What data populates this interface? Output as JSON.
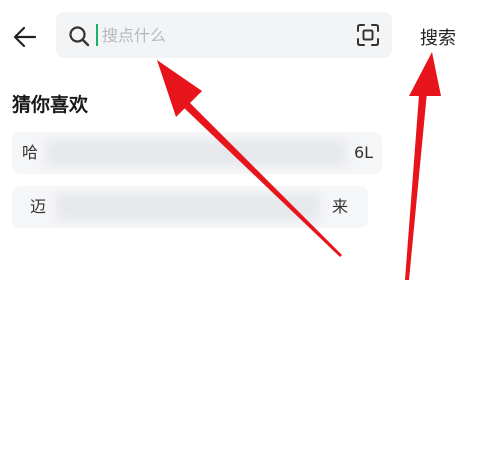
{
  "header": {
    "back_icon": "arrow-left-icon",
    "search": {
      "placeholder": "搜点什么",
      "value": "",
      "search_icon": "search-icon",
      "scan_icon": "scan-icon"
    },
    "search_button_label": "搜索"
  },
  "suggestions": {
    "title": "猜你喜欢",
    "items": [
      {
        "start": "哈",
        "end": "6L"
      },
      {
        "start": "迈",
        "end": "来"
      }
    ]
  },
  "colors": {
    "caret": "#16b36a",
    "annotation_arrow": "#e8141c",
    "chip_background": "#f5f6f8",
    "search_background": "#f3f4f6"
  }
}
